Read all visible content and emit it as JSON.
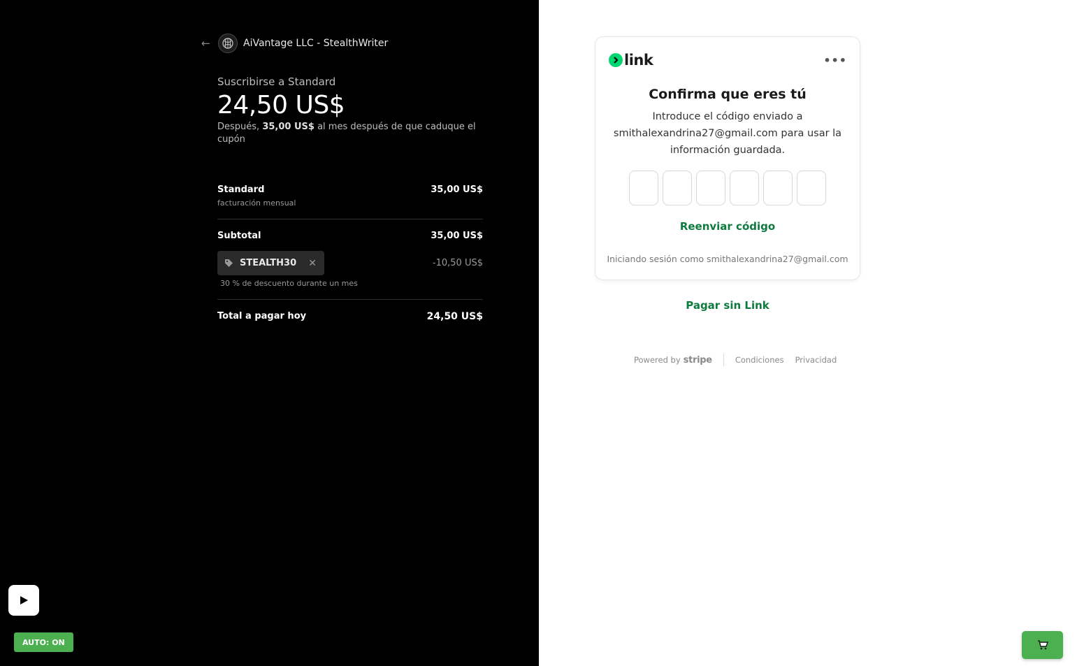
{
  "merchant": {
    "name": "AiVantage LLC - StealthWriter"
  },
  "summary": {
    "subscribe_label": "Suscribirse a Standard",
    "price": "24,50 US$",
    "after_prefix": "Después,",
    "after_amount": "35,00 US$",
    "after_suffix": "al mes después de que caduque el cupón"
  },
  "line_item": {
    "name": "Standard",
    "billing": "facturación mensual",
    "amount": "35,00 US$"
  },
  "subtotal": {
    "label": "Subtotal",
    "amount": "35,00 US$"
  },
  "coupon": {
    "code": "STEALTH30",
    "discount": "-10,50 US$",
    "description": "30 % de descuento durante un mes"
  },
  "total": {
    "label": "Total a pagar hoy",
    "amount": "24,50 US$"
  },
  "controls": {
    "auto_label": "AUTO: ON"
  },
  "link_card": {
    "logo_text": "link",
    "title": "Confirma que eres tú",
    "description": "Introduce el código enviado a smithalexandrina27@gmail.com para usar la información guardada.",
    "resend_label": "Reenviar código",
    "signed_in_text": "Iniciando sesión como smithalexandrina27@gmail.com"
  },
  "pay_without_link": "Pagar sin Link",
  "footer": {
    "powered_by": "Powered by",
    "brand": "stripe",
    "terms": "Condiciones",
    "privacy": "Privacidad"
  },
  "colors": {
    "link_green": "#00d66f",
    "action_green": "#0d7a3e",
    "auto_green": "#4caf50"
  }
}
